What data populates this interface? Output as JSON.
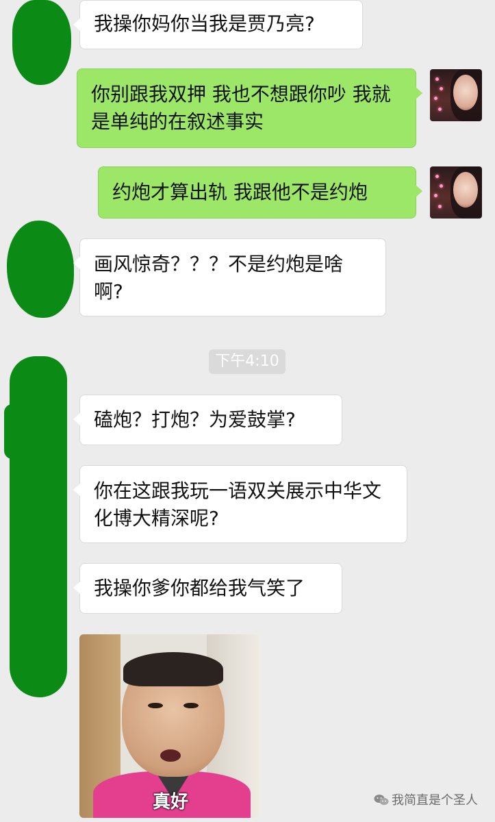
{
  "chat": {
    "messages": [
      {
        "side": "in",
        "text": "我操你妈你当我是贾乃亮?"
      },
      {
        "side": "out",
        "text": "你别跟我双押 我也不想跟你吵 我就是单纯的在叙述事实"
      },
      {
        "side": "out",
        "text": "约炮才算出轨  我跟他不是约炮"
      },
      {
        "side": "in",
        "text": "画风惊奇？？？不是约炮是啥啊?"
      },
      {
        "side": "in",
        "text": "磕炮？打炮？为爱鼓掌?"
      },
      {
        "side": "in",
        "text": "你在这跟我玩一语双关展示中华文化博大精深呢?"
      },
      {
        "side": "in",
        "text": "我操你爹你都给我气笑了"
      }
    ],
    "timestamp": "下午4:10",
    "photo_caption": "真好"
  },
  "watermark": {
    "text": "我简直是个圣人",
    "icon": "wechat-icon"
  },
  "colors": {
    "background": "#ececec",
    "incoming_bubble": "#ffffff",
    "outgoing_bubble": "#9de768",
    "redaction": "#0c8a16"
  }
}
